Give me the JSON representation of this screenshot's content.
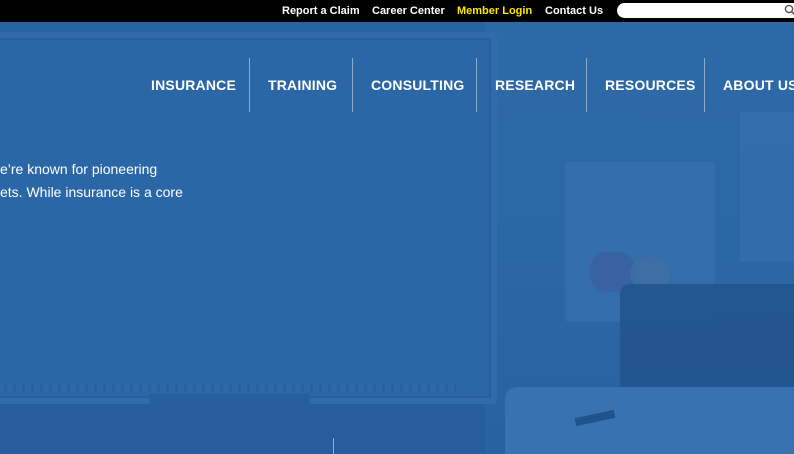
{
  "utility_nav": {
    "items": [
      {
        "label": "Report a Claim",
        "color": "#ffffff"
      },
      {
        "label": "Career Center",
        "color": "#ffffff"
      },
      {
        "label": "Member Login",
        "color": "#ffe600"
      },
      {
        "label": "Contact Us",
        "color": "#ffffff"
      }
    ],
    "search": {
      "placeholder": "",
      "icon": "search-icon"
    }
  },
  "main_nav": {
    "items": [
      {
        "label": "INSURANCE"
      },
      {
        "label": "TRAINING"
      },
      {
        "label": "CONSULTING"
      },
      {
        "label": "RESEARCH"
      },
      {
        "label": "RESOURCES"
      },
      {
        "label": "ABOUT US"
      }
    ]
  },
  "hero": {
    "lines": [
      "e’re known for pioneering",
      "ets. While insurance is a core"
    ]
  },
  "colors": {
    "topbar": "#000000",
    "accent_member": "#ffe600",
    "hero_blue": "#2f6aa6",
    "text": "#ffffff"
  }
}
